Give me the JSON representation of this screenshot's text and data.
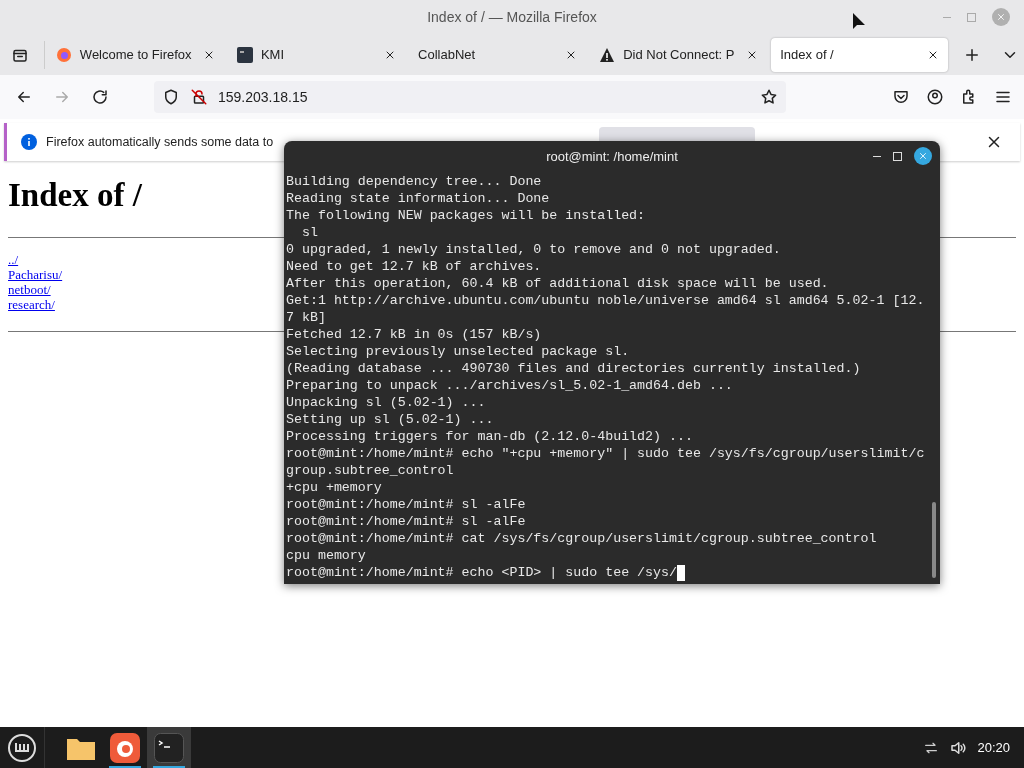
{
  "window": {
    "title": "Index of / — Mozilla Firefox"
  },
  "tabs": [
    {
      "label": "Welcome to Firefox",
      "kind": "firefox",
      "selected": false
    },
    {
      "label": "KMI",
      "kind": "app",
      "selected": false
    },
    {
      "label": "CollabNet",
      "kind": "plain",
      "selected": false
    },
    {
      "label": "Did Not Connect: P",
      "kind": "warning",
      "selected": false
    },
    {
      "label": "Index of /",
      "kind": "plain",
      "selected": true
    }
  ],
  "address": {
    "value": "159.203.18.15"
  },
  "notification": {
    "text": "Firefox automatically sends some data to"
  },
  "page": {
    "heading": "Index of /",
    "links": [
      "../",
      "Pacharisu/",
      "netboot/",
      "research/"
    ]
  },
  "terminal": {
    "title": "root@mint: /home/mint",
    "lines": [
      "Building dependency tree... Done",
      "Reading state information... Done",
      "The following NEW packages will be installed:",
      "  sl",
      "0 upgraded, 1 newly installed, 0 to remove and 0 not upgraded.",
      "Need to get 12.7 kB of archives.",
      "After this operation, 60.4 kB of additional disk space will be used.",
      "Get:1 http://archive.ubuntu.com/ubuntu noble/universe amd64 sl amd64 5.02-1 [12.",
      "7 kB]",
      "Fetched 12.7 kB in 0s (157 kB/s)",
      "Selecting previously unselected package sl.",
      "(Reading database ... 490730 files and directories currently installed.)",
      "Preparing to unpack .../archives/sl_5.02-1_amd64.deb ...",
      "Unpacking sl (5.02-1) ...",
      "Setting up sl (5.02-1) ...",
      "Processing triggers for man-db (2.12.0-4build2) ...",
      "root@mint:/home/mint# echo \"+cpu +memory\" | sudo tee /sys/fs/cgroup/userslimit/c",
      "group.subtree_control",
      "+cpu +memory",
      "root@mint:/home/mint# sl -alFe",
      "root@mint:/home/mint# sl -alFe",
      "root@mint:/home/mint# cat /sys/fs/cgroup/userslimit/cgroup.subtree_control",
      "cpu memory",
      "root@mint:/home/mint# echo <PID> | sudo tee /sys/"
    ]
  },
  "taskbar": {
    "apps": [
      {
        "kind": "folder",
        "active": false
      },
      {
        "kind": "firefox",
        "active": true
      },
      {
        "kind": "terminal",
        "active": true
      }
    ],
    "clock": "20:20"
  }
}
